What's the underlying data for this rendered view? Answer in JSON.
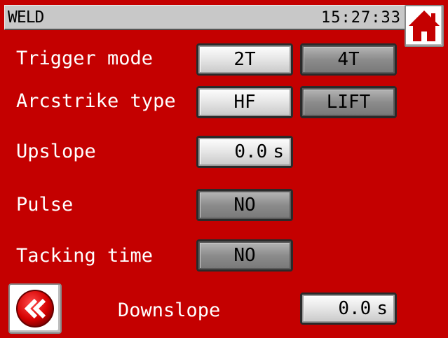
{
  "titlebar": {
    "title": "WELD",
    "clock": "15:27:33"
  },
  "icons": {
    "home": "home-icon",
    "back": "double-chevron-left-icon"
  },
  "colors": {
    "background": "#c40000",
    "home_icon": "#c40000",
    "back_icon": "#d40000"
  },
  "rows": {
    "trigger_mode": {
      "label": "Trigger mode",
      "options": [
        "2T",
        "4T"
      ],
      "selected": "2T"
    },
    "arcstrike_type": {
      "label": "Arcstrike type",
      "options": [
        "HF",
        "LIFT"
      ],
      "selected": "HF"
    },
    "upslope": {
      "label": "Upslope",
      "value": "0.0",
      "unit": "s"
    },
    "pulse": {
      "label": "Pulse",
      "value": "NO"
    },
    "tacking_time": {
      "label": "Tacking time",
      "value": "NO"
    },
    "downslope": {
      "label": "Downslope",
      "value": "0.0",
      "unit": "s"
    }
  }
}
